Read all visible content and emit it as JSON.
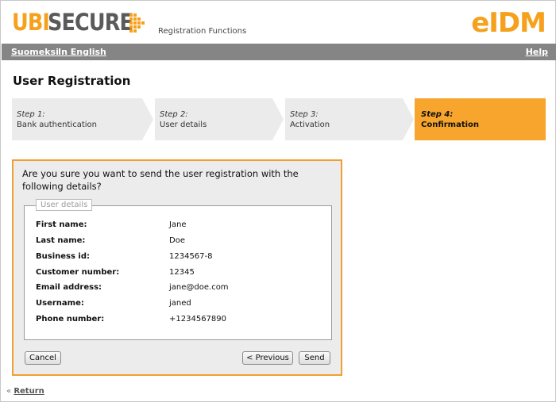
{
  "header": {
    "logo_part1": "UBI",
    "logo_part2": "SECURE",
    "subtitle": "Registration Functions",
    "product": "eIDM",
    "brand_color": "#f5a11c"
  },
  "nav": {
    "lang_fi": "Suomeksi",
    "lang_en": "In English",
    "help": "Help",
    "bg_color": "#858585"
  },
  "page": {
    "title": "User Registration"
  },
  "steps": [
    {
      "number": "Step 1:",
      "label": "Bank authentication"
    },
    {
      "number": "Step 2:",
      "label": "User details"
    },
    {
      "number": "Step 3:",
      "label": "Activation"
    },
    {
      "number": "Step 4:",
      "label": "Confirmation",
      "active": true
    }
  ],
  "confirm": {
    "question": "Are you sure you want to send the user registration with the following details?",
    "legend": "User details",
    "fields": [
      {
        "label": "First name:",
        "value": "Jane"
      },
      {
        "label": "Last name:",
        "value": "Doe"
      },
      {
        "label": "Business id:",
        "value": "1234567-8"
      },
      {
        "label": "Customer number:",
        "value": "12345"
      },
      {
        "label": "Email address:",
        "value": "jane@doe.com"
      },
      {
        "label": "Username:",
        "value": "janed"
      },
      {
        "label": "Phone number:",
        "value": "+1234567890"
      }
    ],
    "cancel_label": "Cancel",
    "previous_label": "< Previous",
    "send_label": "Send"
  },
  "footer": {
    "return_prefix": "«",
    "return_label": "Return"
  }
}
